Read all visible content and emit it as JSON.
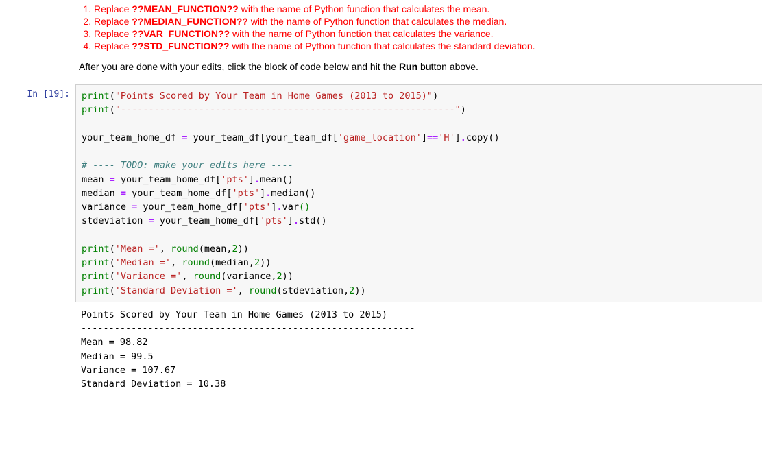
{
  "instructions": {
    "items": [
      {
        "prefix": "Replace ",
        "placeholder": "??MEAN_FUNCTION??",
        "suffix": " with the name of Python function that calculates the mean."
      },
      {
        "prefix": "Replace ",
        "placeholder": "??MEDIAN_FUNCTION??",
        "suffix": " with the name of Python function that calculates the median."
      },
      {
        "prefix": "Replace ",
        "placeholder": "??VAR_FUNCTION??",
        "suffix": " with the name of Python function that calculates the variance."
      },
      {
        "prefix": "Replace ",
        "placeholder": "??STD_FUNCTION??",
        "suffix": " with the name of Python function that calculates the standard deviation."
      }
    ],
    "after_note_pre": "After you are done with your edits, click the block of code below and hit the ",
    "after_note_bold": "Run",
    "after_note_post": " button above."
  },
  "cell": {
    "prompt_in": "In ",
    "prompt_open": "[",
    "prompt_num": "19",
    "prompt_close": "]:"
  },
  "code": {
    "l1_print": "print",
    "l1_paren_open": "(",
    "l1_str": "\"Points Scored by Your Team in Home Games (2013 to 2015)\"",
    "l1_paren_close": ")",
    "l2_print": "print",
    "l2_paren_open": "(",
    "l2_str": "\"------------------------------------------------------------\"",
    "l2_paren_close": ")",
    "blank1": "",
    "l4_name": "your_team_home_df ",
    "l4_op": "=",
    "l4_rest1": " your_team_df[your_team_df[",
    "l4_str": "'game_location'",
    "l4_rest2": "]",
    "l4_eqeq": "==",
    "l4_str2": "'H'",
    "l4_rest3": "]",
    "l4_dot": ".",
    "l4_copy": "copy()",
    "blank2": "",
    "l6_comment": "# ---- TODO: make your edits here ----",
    "l7_name": "mean ",
    "l7_op": "=",
    "l7_rest": " your_team_home_df[",
    "l7_str": "'pts'",
    "l7_rest2": "]",
    "l7_dot": ".",
    "l7_call": "mean()",
    "l8_name": "median ",
    "l8_op": "=",
    "l8_rest": " your_team_home_df[",
    "l8_str": "'pts'",
    "l8_rest2": "]",
    "l8_dot": ".",
    "l8_call": "median()",
    "l9_name": "variance ",
    "l9_op": "=",
    "l9_rest": " your_team_home_df[",
    "l9_str": "'pts'",
    "l9_rest2": "]",
    "l9_dot": ".",
    "l9_call": "var",
    "l9_paren": "()",
    "l10_name": "stdeviation ",
    "l10_op": "=",
    "l10_rest": " your_team_home_df[",
    "l10_str": "'pts'",
    "l10_rest2": "]",
    "l10_dot": ".",
    "l10_call": "std()",
    "blank3": "",
    "l12_print": "print",
    "l12_open": "(",
    "l12_str": "'Mean ='",
    "l12_comma": ", ",
    "l12_round": "round",
    "l12_args": "(mean,",
    "l12_num": "2",
    "l12_close": "))",
    "l13_print": "print",
    "l13_open": "(",
    "l13_str": "'Median ='",
    "l13_comma": ", ",
    "l13_round": "round",
    "l13_args": "(median,",
    "l13_num": "2",
    "l13_close": "))",
    "l14_print": "print",
    "l14_open": "(",
    "l14_str": "'Variance ='",
    "l14_comma": ", ",
    "l14_round": "round",
    "l14_args": "(variance,",
    "l14_num": "2",
    "l14_close": "))",
    "l15_print": "print",
    "l15_open": "(",
    "l15_str": "'Standard Deviation ='",
    "l15_comma": ", ",
    "l15_round": "round",
    "l15_args": "(stdeviation,",
    "l15_num": "2",
    "l15_close": "))"
  },
  "output": {
    "line1": "Points Scored by Your Team in Home Games (2013 to 2015)",
    "line2": "------------------------------------------------------------",
    "line3": "Mean = 98.82",
    "line4": "Median = 99.5",
    "line5": "Variance = 107.67",
    "line6": "Standard Deviation = 10.38"
  }
}
